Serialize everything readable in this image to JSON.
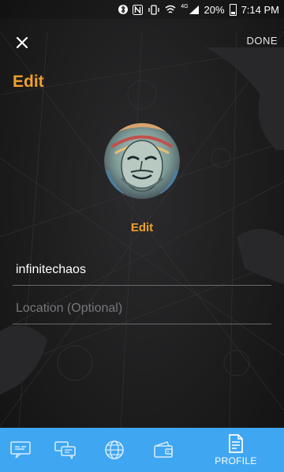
{
  "status_bar": {
    "network": "4G",
    "battery": "20%",
    "time": "7:14 PM"
  },
  "header": {
    "title": "Edit",
    "done_label": "DONE"
  },
  "profile": {
    "edit_photo_label": "Edit",
    "username_value": "infinitechaos",
    "location_placeholder": "Location (Optional)"
  },
  "bottom_nav": {
    "items": [
      {
        "icon": "feed-icon"
      },
      {
        "icon": "chat-icon"
      },
      {
        "icon": "globe-icon"
      },
      {
        "icon": "wallet-icon"
      },
      {
        "icon": "profile-icon",
        "label": "PROFILE"
      }
    ]
  },
  "colors": {
    "accent": "#f0a030",
    "nav_bar": "#3fa6f1",
    "background": "#1d1d1e"
  }
}
